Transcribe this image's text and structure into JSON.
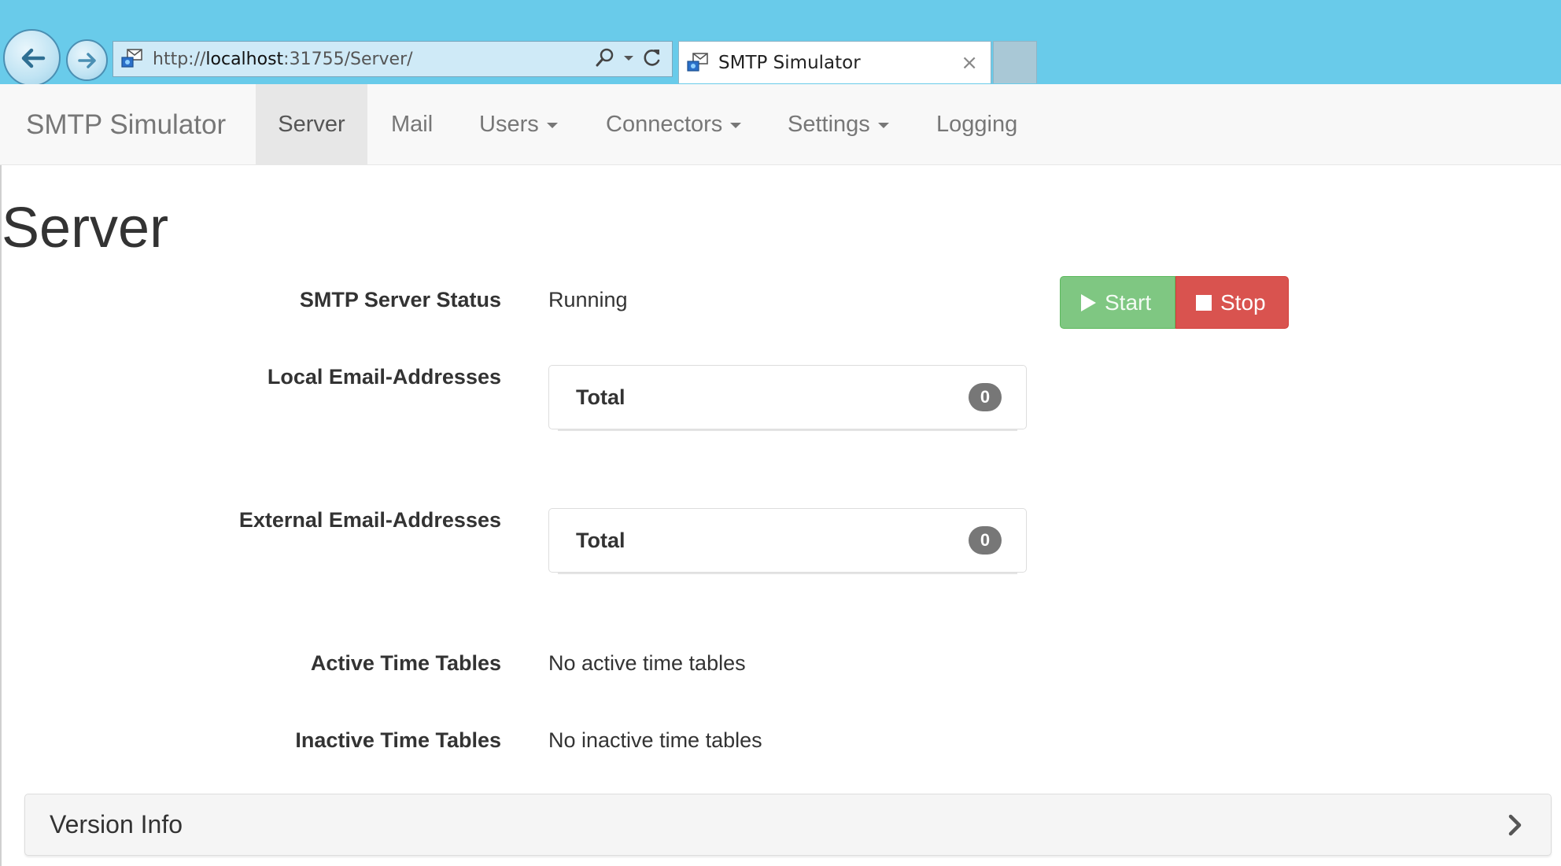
{
  "browser": {
    "url_prefix": "http://",
    "url_host": "localhost",
    "url_rest": ":31755/Server/",
    "tab_title": "SMTP Simulator",
    "tab_close": "×",
    "icons": {
      "back": "back-arrow-icon",
      "forward": "forward-arrow-icon",
      "favicon": "mail-favicon-icon",
      "search": "search-icon",
      "dropdown": "chevron-down-icon",
      "refresh": "refresh-icon"
    }
  },
  "navbar": {
    "brand": "SMTP Simulator",
    "items": [
      {
        "label": "Server",
        "active": true,
        "dropdown": false
      },
      {
        "label": "Mail",
        "active": false,
        "dropdown": false
      },
      {
        "label": "Users",
        "active": false,
        "dropdown": true
      },
      {
        "label": "Connectors",
        "active": false,
        "dropdown": true
      },
      {
        "label": "Settings",
        "active": false,
        "dropdown": true
      },
      {
        "label": "Logging",
        "active": false,
        "dropdown": false
      }
    ]
  },
  "page": {
    "title": "Server",
    "status_label": "SMTP Server Status",
    "status_value": "Running",
    "buttons": {
      "start": "Start",
      "stop": "Stop",
      "start_color": "#7fc782",
      "stop_color": "#d9534f"
    },
    "local_label": "Local Email-Addresses",
    "local_total_label": "Total",
    "local_total_count": "0",
    "external_label": "External Email-Addresses",
    "external_total_label": "Total",
    "external_total_count": "0",
    "active_tt_label": "Active Time Tables",
    "active_tt_value": "No active time tables",
    "inactive_tt_label": "Inactive Time Tables",
    "inactive_tt_value": "No inactive time tables",
    "version_panel_title": "Version Info"
  },
  "colors": {
    "chrome_bg": "#69cbea",
    "navbar_bg": "#f8f8f8",
    "nav_active_bg": "#e7e7e7",
    "badge_bg": "#777777"
  }
}
